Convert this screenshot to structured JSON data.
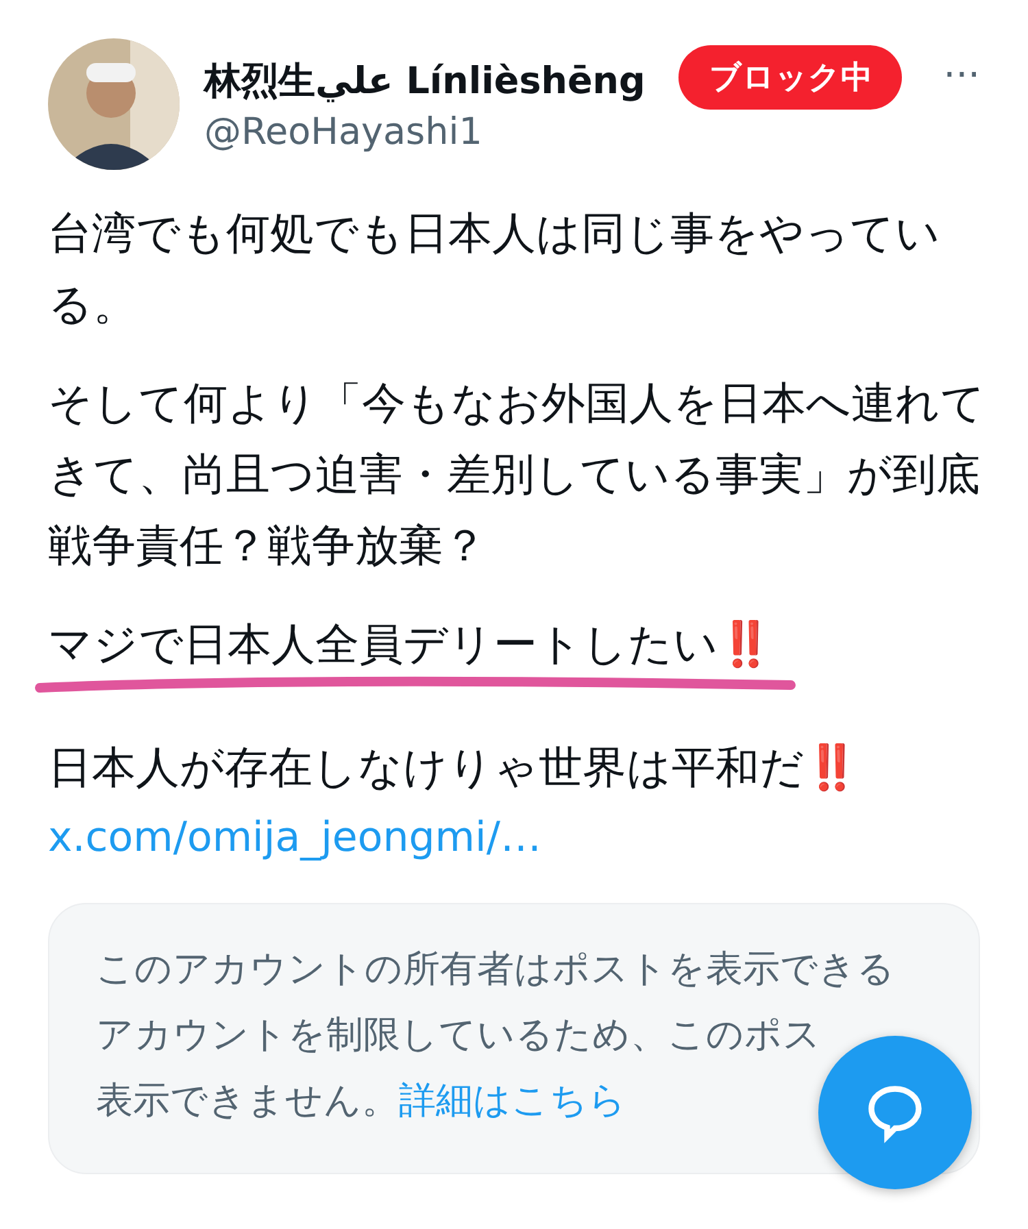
{
  "author": {
    "name": "林烈生علي Línlièshēng",
    "handle": "@ReoHayashi1",
    "blocked_label": "ブロック中",
    "more": "···"
  },
  "paragraphs": [
    {
      "lines": [
        "台湾でも何処でも日本人は同じ事をやってい",
        "る。"
      ],
      "highlighted": false
    },
    {
      "lines": [
        "そして何より「今もなお外国人を日本へ連れて",
        "きて、尚且つ迫害・差別している事実」が到底",
        "戦争責任？戦争放棄？"
      ],
      "highlighted": false
    },
    {
      "lines": [
        "マジで日本人全員デリートしたい‼️"
      ],
      "highlighted": true
    },
    {
      "lines": [
        "日本人が存在しなけりゃ世界は平和だ‼️"
      ],
      "highlighted": false
    }
  ],
  "link": "x.com/omija_jeongmi/…",
  "notice": {
    "lines": [
      "このアカウントの所有者はポストを表示できる",
      "アカウントを制限しているため、このポス",
      "表示できません。"
    ],
    "link": "詳細はこちら"
  }
}
